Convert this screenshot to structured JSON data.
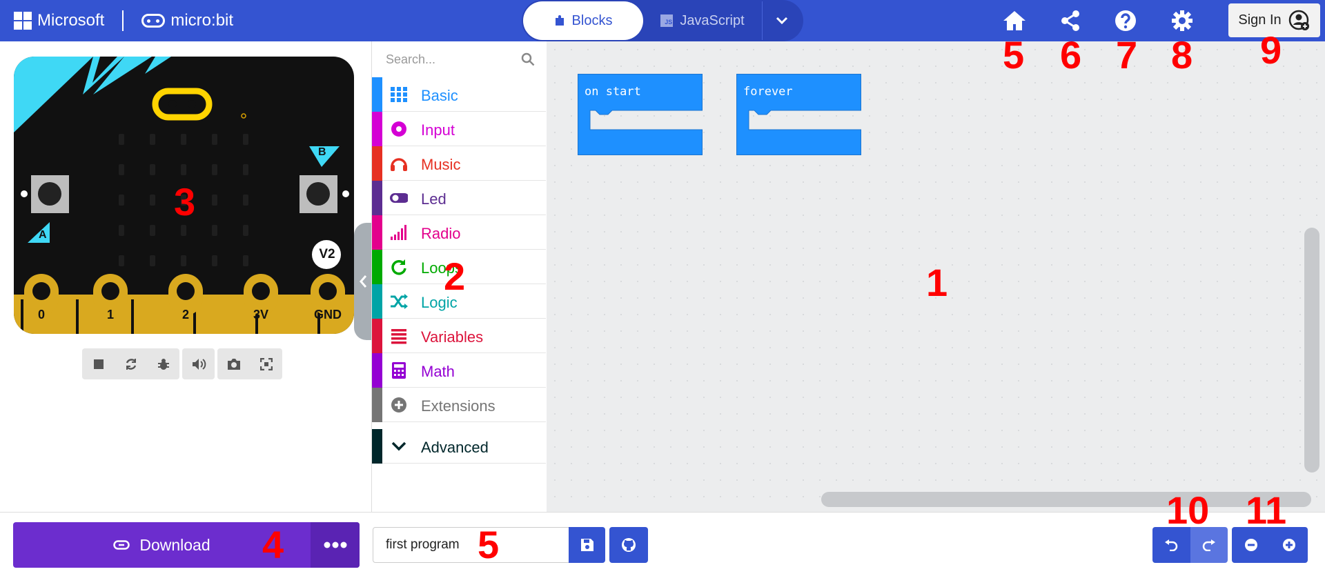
{
  "header": {
    "microsoft_label": "Microsoft",
    "microbit_label": "micro:bit",
    "tabs": {
      "blocks": "Blocks",
      "javascript": "JavaScript"
    },
    "sign_in": "Sign In"
  },
  "simulator": {
    "pins": [
      "0",
      "1",
      "2",
      "3V",
      "GND"
    ],
    "button_a": "A",
    "button_b": "B",
    "version_badge": "V2"
  },
  "toolbox": {
    "search_placeholder": "Search...",
    "categories": [
      {
        "label": "Basic",
        "color": "#1e90ff"
      },
      {
        "label": "Input",
        "color": "#d400d4"
      },
      {
        "label": "Music",
        "color": "#e63022"
      },
      {
        "label": "Led",
        "color": "#5c2d91"
      },
      {
        "label": "Radio",
        "color": "#e3008c"
      },
      {
        "label": "Loops",
        "color": "#00aa00"
      },
      {
        "label": "Logic",
        "color": "#00a4a6"
      },
      {
        "label": "Variables",
        "color": "#dc143c"
      },
      {
        "label": "Math",
        "color": "#9400d3"
      },
      {
        "label": "Extensions",
        "color": "#757575"
      }
    ],
    "advanced": {
      "label": "Advanced",
      "color": "#00272b"
    }
  },
  "workspace": {
    "blocks": [
      {
        "label": "on start"
      },
      {
        "label": "forever"
      }
    ],
    "block_color": "#1e90ff"
  },
  "footer": {
    "download_label": "Download",
    "project_name": "first program"
  },
  "annotations": [
    "1",
    "2",
    "3",
    "4",
    "5",
    "5",
    "6",
    "7",
    "8",
    "9",
    "10",
    "11"
  ],
  "colors": {
    "header": "#3454d1",
    "download": "#6c2dce",
    "annotation": "#ff0000"
  }
}
